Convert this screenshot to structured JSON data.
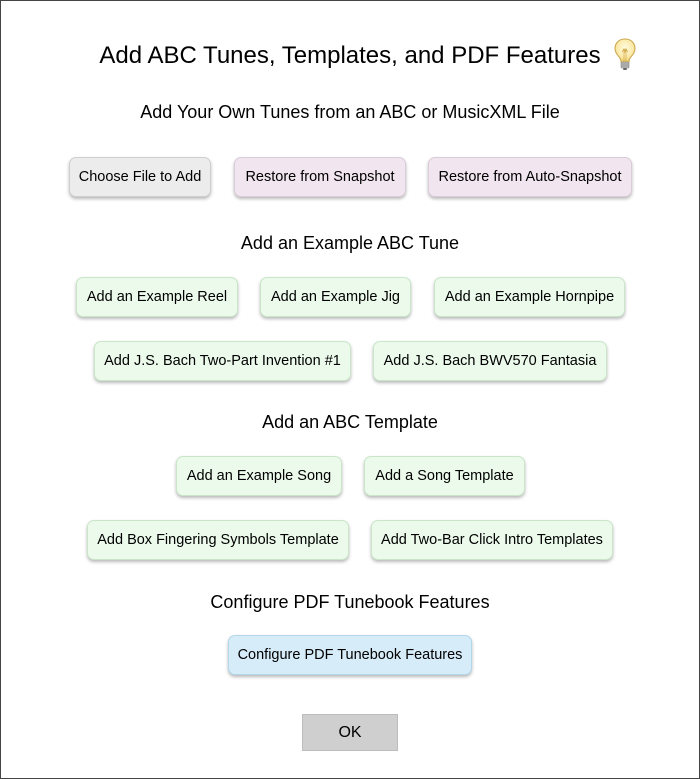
{
  "dialog": {
    "title": "Add ABC Tunes, Templates, and PDF Features",
    "help_icon": "lightbulb-icon"
  },
  "section_own": {
    "title": "Add Your Own Tunes from an ABC or MusicXML File",
    "choose_file": "Choose File to Add",
    "restore_snapshot": "Restore from Snapshot",
    "restore_auto_snapshot": "Restore from Auto-Snapshot"
  },
  "section_example": {
    "title": "Add an Example ABC Tune",
    "reel": "Add an Example Reel",
    "jig": "Add an Example Jig",
    "hornpipe": "Add an Example Hornpipe",
    "bach_invention": "Add J.S. Bach Two-Part Invention #1",
    "bach_fantasia": "Add J.S. Bach BWV570 Fantasia"
  },
  "section_template": {
    "title": "Add an ABC Template",
    "example_song": "Add an Example Song",
    "song_template": "Add a Song Template",
    "box_fingering": "Add Box Fingering Symbols Template",
    "two_bar_click": "Add Two-Bar Click Intro Templates"
  },
  "section_pdf": {
    "title": "Configure PDF Tunebook Features",
    "configure": "Configure PDF Tunebook Features"
  },
  "ok_label": "OK",
  "colors": {
    "gray_button": "#ececec",
    "purple_button": "#f1e6ef",
    "green_button": "#ecfaec",
    "blue_button": "#d6ecf9",
    "ok_button": "#cfcfcf"
  }
}
